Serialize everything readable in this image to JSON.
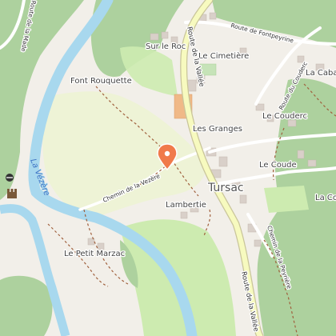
{
  "map": {
    "places": {
      "tursac": "Tursac",
      "sur_le_roc": "Sur le Roc",
      "le_cimetiere": "Le Cimetière",
      "font_rouquette": "Font Rouquette",
      "les_granges": "Les Granges",
      "le_couderc": "Le Couderc",
      "le_coude": "Le Coude",
      "lambertie": "Lambertie",
      "le_petit_marzac": "Le Petit Marzac",
      "la_caba": "La Caba",
      "la_co": "La Co"
    },
    "roads": {
      "route_de_la_vallee_north": "Route de la Vallée",
      "route_de_la_vallee_south": "Route de la Vallée",
      "route_de_fontpeyrine": "Route de Fontpeyrine",
      "route_du_couderc": "Route du Couderc",
      "chemin_de_la_vezere": "Chemin de la Vezère",
      "chemin_de_la_peyriere": "Chemin de la Peyrière",
      "route_de_la_made": "Route de la Made"
    },
    "water": {
      "river_name": "La Vézère"
    },
    "marker": {
      "icon": "location-pin-icon",
      "color": "#f07a4a"
    },
    "colors": {
      "forest": "#add19e",
      "grass": "#cdebb0",
      "water": "#a8d8ee",
      "land": "#f2efe9",
      "main_road": "#f7fabf",
      "road_casing": "#c9c59a",
      "path": "#a0603d"
    },
    "icons": {
      "castle": "castle-icon",
      "viewpoint": "viewpoint-icon"
    }
  }
}
